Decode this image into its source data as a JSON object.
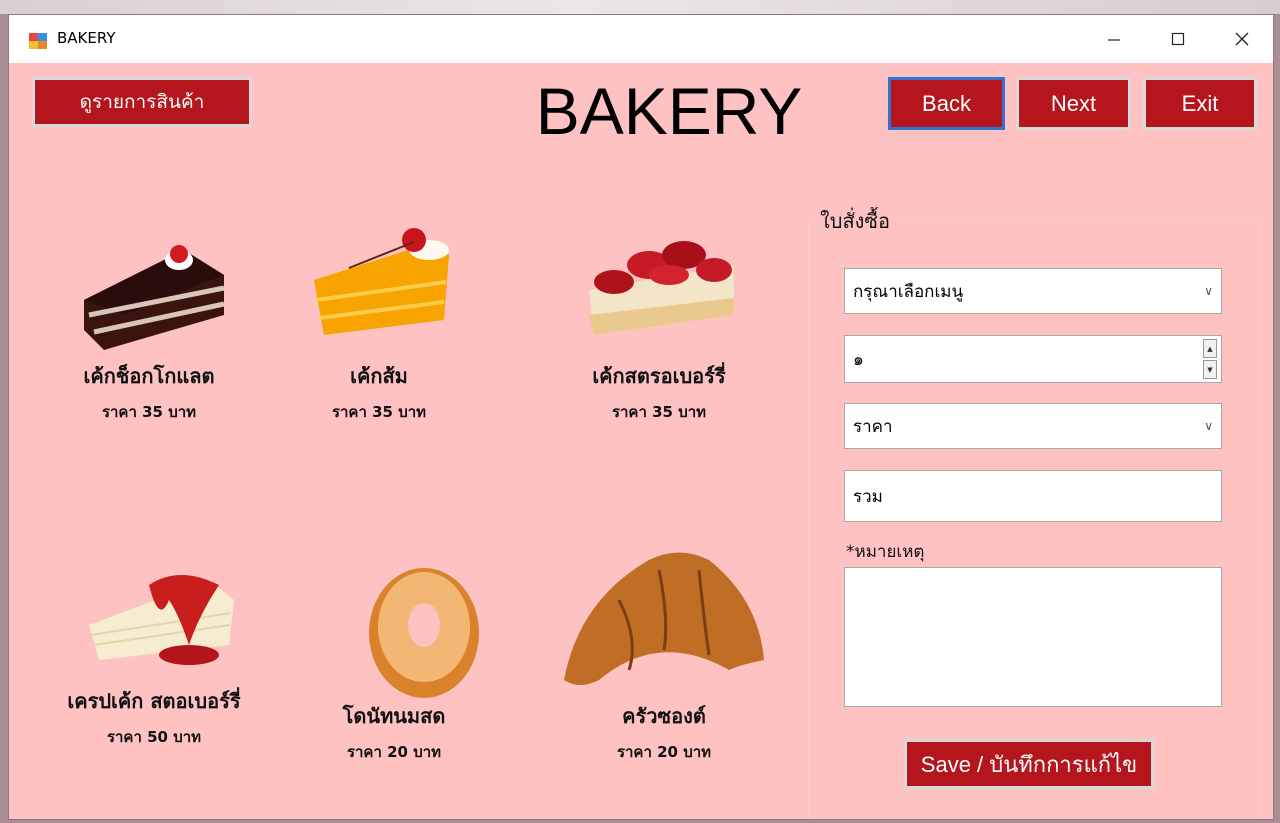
{
  "window": {
    "title": "BAKERY"
  },
  "header": {
    "view_products_label": "ดูรายการสินค้า",
    "title": "BAKERY",
    "back_label": "Back",
    "next_label": "Next",
    "exit_label": "Exit"
  },
  "products": [
    {
      "name": "เค้กช็อกโกแลต",
      "price": "ราคา 35 บาท",
      "icon": "chocolate-cake-icon"
    },
    {
      "name": "เค้กส้ม",
      "price": "ราคา 35 บาท",
      "icon": "orange-cake-icon"
    },
    {
      "name": "เค้กสตรอเบอร์รี่",
      "price": "ราคา 35 บาท",
      "icon": "strawberry-cake-icon"
    },
    {
      "name": "เครปเค้ก สตอเบอร์รี่",
      "price": "ราคา 50 บาท",
      "icon": "crepe-cake-icon"
    },
    {
      "name": "โดนัทนมสด",
      "price": "ราคา 20 บาท",
      "icon": "donut-icon"
    },
    {
      "name": "ครัวซองต์",
      "price": "ราคา 20 บาท",
      "icon": "croissant-icon"
    }
  ],
  "order": {
    "legend": "ใบสั่งซื้อ",
    "menu_select": "กรุณาเลือกเมนู",
    "quantity": "๑",
    "price_select": "ราคา",
    "total": "รวม",
    "note_label": "*หมายเหตุ",
    "note_value": "",
    "save_label": "Save / บันทึกการแก้ไข"
  },
  "colors": {
    "background": "#ffc2c2",
    "button": "#b5161e",
    "focus_border": "#2f74d0"
  }
}
